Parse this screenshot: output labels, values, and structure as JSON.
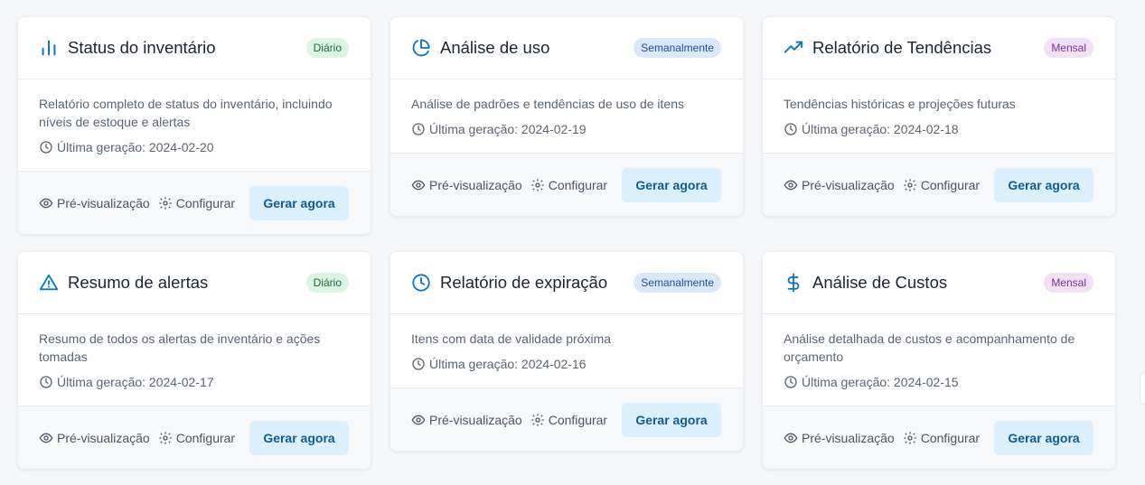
{
  "cards": [
    {
      "title": "Status do inventário",
      "icon": "bar-chart-icon",
      "badge": "Diário",
      "badge_color": "green",
      "description": "Relatório completo de status do inventário, incluindo níveis de estoque e alertas",
      "last_generated": "Última geração: 2024-02-20"
    },
    {
      "title": "Análise de uso",
      "icon": "pie-chart-icon",
      "badge": "Semanalmente",
      "badge_color": "blue",
      "description": "Análise de padrões e tendências de uso de itens",
      "last_generated": "Última geração: 2024-02-19"
    },
    {
      "title": "Relatório de Tendências",
      "icon": "trending-up-icon",
      "badge": "Mensal",
      "badge_color": "purple",
      "description": "Tendências históricas e projeções futuras",
      "last_generated": "Última geração: 2024-02-18"
    },
    {
      "title": "Resumo de alertas",
      "icon": "alert-triangle-icon",
      "badge": "Diário",
      "badge_color": "green",
      "description": "Resumo de todos os alertas de inventário e ações tomadas",
      "last_generated": "Última geração: 2024-02-17"
    },
    {
      "title": "Relatório de expiração",
      "icon": "clock-icon",
      "badge": "Semanalmente",
      "badge_color": "blue",
      "description": "Itens com data de validade próxima",
      "last_generated": "Última geração: 2024-02-16"
    },
    {
      "title": "Análise de Custos",
      "icon": "dollar-icon",
      "badge": "Mensal",
      "badge_color": "purple",
      "description": "Análise detalhada de custos e acompanhamento de orçamento",
      "last_generated": "Última geração: 2024-02-15"
    }
  ],
  "actions": {
    "preview_label": "Pré-visualização",
    "configure_label": "Configurar",
    "generate_label": "Gerar agora"
  },
  "colors": {
    "accent": "#0b76c5",
    "generate_bg": "#dceffd",
    "generate_text": "#0f5b94"
  }
}
